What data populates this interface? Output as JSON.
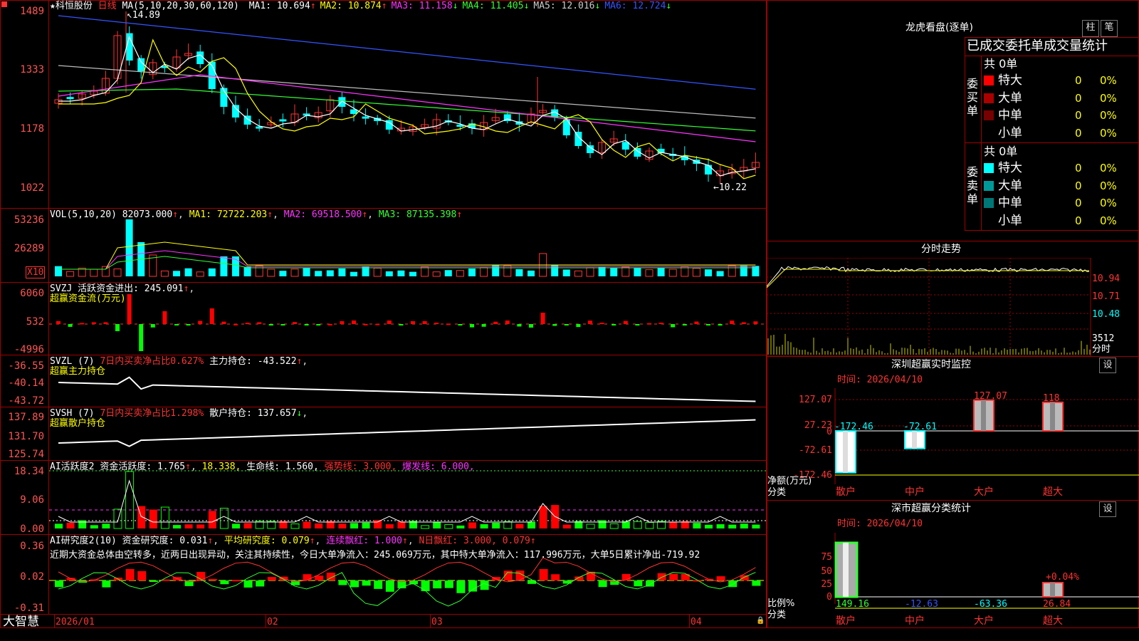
{
  "stock": {
    "name": "科恒股份",
    "period": "日线",
    "ma_params": "MA(5,10,20,30,60,120)",
    "ma": [
      {
        "label": "MA1: 10.694",
        "arrow": "↑",
        "color": "#ffffff"
      },
      {
        "label": "MA2: 10.874",
        "arrow": "↑",
        "color": "#ffff00"
      },
      {
        "label": "MA3: 11.158",
        "arrow": "↓",
        "color": "#ff33ff"
      },
      {
        "label": "MA4: 11.405",
        "arrow": "↓",
        "color": "#33ff33"
      },
      {
        "label": "MA5: 12.016",
        "arrow": "↓",
        "color": "#cccccc"
      },
      {
        "label": "MA6: 12.724",
        "arrow": "↓",
        "color": "#3355ff"
      }
    ],
    "high_mark": "14.89",
    "low_mark": "10.22",
    "price_axis": [
      "1489",
      "1333",
      "1178",
      "1022"
    ]
  },
  "vol": {
    "header": "VOL(5,10,20)",
    "value": "82073.000",
    "ma1": "MA1: 72722.203",
    "ma2": "MA2: 69518.500",
    "ma3": "MA3: 87135.398",
    "axis": [
      "53236",
      "26289"
    ],
    "unit": "X10"
  },
  "svzj": {
    "header": "SVZJ",
    "label": "活跃资金进出: 245.091",
    "title": "超赢资金流(万元)",
    "axis": [
      "6060",
      "532",
      "-4996"
    ]
  },
  "svzl": {
    "header": "SVZL (7)",
    "ratio": "7日内买卖净占比0.627%",
    "hold": "主力持仓: -43.522",
    "title": "超赢主力持仓",
    "axis": [
      "-36.55",
      "-40.14",
      "-43.72"
    ]
  },
  "svsh": {
    "header": "SVSH (7)",
    "ratio": "7日内买卖净占比1.298%",
    "hold": "散户持仓: 137.657",
    "title": "超赢散户持仓",
    "axis": [
      "137.89",
      "131.70",
      "125.74"
    ]
  },
  "ai1": {
    "header": "AI活跃度2",
    "a": "资金活跃度: 1.765",
    "b": "18.338,",
    "c": "生命线: 1.560,",
    "d": "强势线: 3.000,",
    "e": "爆发线: 6.000,",
    "axis": [
      "18.34",
      "9.06",
      "0.00"
    ]
  },
  "ai2": {
    "header": "AI研究度2(10)",
    "a": "资金研究度: 0.031",
    "b": "平均研究度: 0.079",
    "c": "连续飘红: 1.000",
    "d": "N日飘红: 3.000, 0.079",
    "note": "近期大资金总体由空转多，近两日出现异动，关注其持续性，今日大单净流入：245.069万元，其中特大单净流入：117.996万元，大单5日累计净出-719.92",
    "axis": [
      "0.36",
      "0.02",
      "-0.31"
    ]
  },
  "bottom": {
    "brand": "大智慧",
    "dates": [
      "2026/01",
      "02",
      "03",
      "04"
    ]
  },
  "right": {
    "dragon_title": "龙虎看盘(逐单)",
    "btn_zhu": "柱",
    "btn_bi": "笔",
    "order_title": "已成交委托单成交量统计",
    "buy_side": {
      "label": "委买单",
      "total": "共 0单",
      "rows": [
        {
          "name": "特大",
          "count": "0",
          "pct": "0%",
          "color": "#ff0000"
        },
        {
          "name": "大单",
          "count": "0",
          "pct": "0%",
          "color": "#aa0000"
        },
        {
          "name": "中单",
          "count": "0",
          "pct": "0%",
          "color": "#770000"
        },
        {
          "name": "小单",
          "count": "0",
          "pct": "0%",
          "color": "#000000"
        }
      ]
    },
    "sell_side": {
      "label": "委卖单",
      "total": "共 0单",
      "rows": [
        {
          "name": "特大",
          "count": "0",
          "pct": "0%",
          "color": "#00ffff"
        },
        {
          "name": "大单",
          "count": "0",
          "pct": "0%",
          "color": "#009999"
        },
        {
          "name": "中单",
          "count": "0",
          "pct": "0%",
          "color": "#007777"
        },
        {
          "name": "小单",
          "count": "0",
          "pct": "0%",
          "color": "#000000"
        }
      ]
    },
    "minute_title": "分时走势",
    "minute_axis": [
      "10.94",
      "10.71",
      "10.48",
      "3512"
    ],
    "minute_unit": "分时",
    "sz_title": "深圳超赢实时监控",
    "sz_btn": "设",
    "sz_time": "时间: 2026/04/10",
    "sz_axis": [
      "127.07",
      "27.23",
      "0",
      "-72.61",
      "-172.46"
    ],
    "sz_ylabel": "净额(万元)",
    "sz_xlabel": "分类",
    "sz_values": [
      {
        "cat": "散户",
        "value": "-172.46",
        "num": -172.46
      },
      {
        "cat": "中户",
        "value": "-72.61",
        "num": -72.61
      },
      {
        "cat": "大户",
        "value": "127.07",
        "num": 127.07
      },
      {
        "cat": "超大",
        "value": "118",
        "num": 118
      }
    ],
    "ss_title": "深市超赢分类统计",
    "ss_btn": "设",
    "ss_time": "时间: 2026/04/10",
    "ss_axis": [
      "75",
      "50",
      "25",
      "0"
    ],
    "ss_ylabel": "比例%",
    "ss_xlabel": "分类",
    "ss_top_label": "+0.04%",
    "ss_values": [
      {
        "cat": "散户",
        "value": "149.16",
        "num": 149.16
      },
      {
        "cat": "中户",
        "value": "-12.63",
        "num": -12.63
      },
      {
        "cat": "大户",
        "value": "-63.36",
        "num": -63.36
      },
      {
        "cat": "超大",
        "value": "26.84",
        "num": 26.84
      }
    ]
  }
}
